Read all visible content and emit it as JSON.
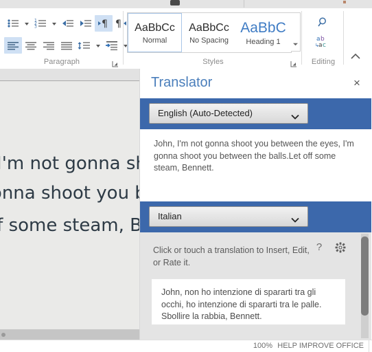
{
  "ribbon": {
    "groups": [
      {
        "name": "Paragraph",
        "label": "Paragraph",
        "dialog_launcher": "dialog-launcher",
        "row1": [
          {
            "icon": "bullet-list-icon",
            "label": "Bullets"
          },
          {
            "icon": "chevron-down-icon",
            "label": "Bullets dropdown"
          },
          {
            "icon": "numbered-list-icon",
            "label": "Numbering"
          },
          {
            "icon": "chevron-down-icon",
            "label": "Numbering dropdown"
          },
          {
            "icon": "decrease-indent-icon",
            "label": "Decrease Indent"
          },
          {
            "icon": "increase-indent-icon",
            "label": "Increase Indent"
          },
          {
            "icon": "ltr-text-direction-icon",
            "label": "Left-to-Right Text Direction"
          },
          {
            "icon": "rtl-text-direction-icon",
            "label": "Right-to-Left Text Direction"
          }
        ],
        "row2": [
          {
            "icon": "align-left-icon",
            "label": "Align Left"
          },
          {
            "icon": "align-center-icon",
            "label": "Center"
          },
          {
            "icon": "align-right-icon",
            "label": "Align Right"
          },
          {
            "icon": "justify-icon",
            "label": "Justify"
          },
          {
            "icon": "line-spacing-icon",
            "label": "Line and Paragraph Spacing"
          },
          {
            "icon": "chevron-down-icon",
            "label": "Line spacing dropdown"
          },
          {
            "icon": "shading-icon",
            "label": "Shading"
          },
          {
            "icon": "chevron-down-icon",
            "label": "Shading dropdown"
          }
        ]
      }
    ],
    "styles": {
      "label": "Styles",
      "dialog_launcher": "dialog-launcher",
      "more_button": "more-styles-icon",
      "items": [
        {
          "sample": "AaBbCc",
          "name": "Normal",
          "selected": true
        },
        {
          "sample": "AaBbCc",
          "name": "No Spacing",
          "selected": false
        },
        {
          "sample": "AaBbC",
          "name": "Heading 1",
          "selected": false
        }
      ]
    },
    "editing": {
      "label": "Editing",
      "find_icon": "magnifier-icon",
      "replace_icon": "replace-ab-ac-icon",
      "collapse_icon": "chevron-up-icon"
    }
  },
  "document": {
    "lines": [
      "John, I'm not gonna shoot you between the eyes,",
      "I'm gonna shoot you between the balls.",
      "Let off some steam, Bennett."
    ],
    "h_scrollbar": "horizontal-scrollbar"
  },
  "translator": {
    "title": "Translator",
    "close_label": "×",
    "from": {
      "language": "English (Auto-Detected)",
      "chevron": "chevron-down-icon"
    },
    "source_text": "John, I'm not gonna shoot you between the eyes, I'm gonna shoot you between the balls.Let off some steam, Bennett.",
    "to": {
      "language": "Italian",
      "chevron": "chevron-down-icon"
    },
    "hint": "Click or touch a translation to Insert, Edit, or Rate it.",
    "help_label": "?",
    "gear_icon": "gear-icon",
    "result_text": "John, non ho intenzione di spararti tra gli occhi, ho intenzione di spararti tra le palle. Sbollire la rabbia, Bennett.",
    "scrollbar": "vertical-scrollbar"
  },
  "status_bar": {
    "zoom": "100%",
    "help": "HELP IMPROVE OFFICE"
  },
  "colors": {
    "accent_blue": "#3c68ab",
    "title_blue": "#4a7ebb",
    "icon_blue": "#3b6ea5",
    "panel_grey": "#e4e4e4",
    "doc_grey": "#e9e9e7"
  }
}
